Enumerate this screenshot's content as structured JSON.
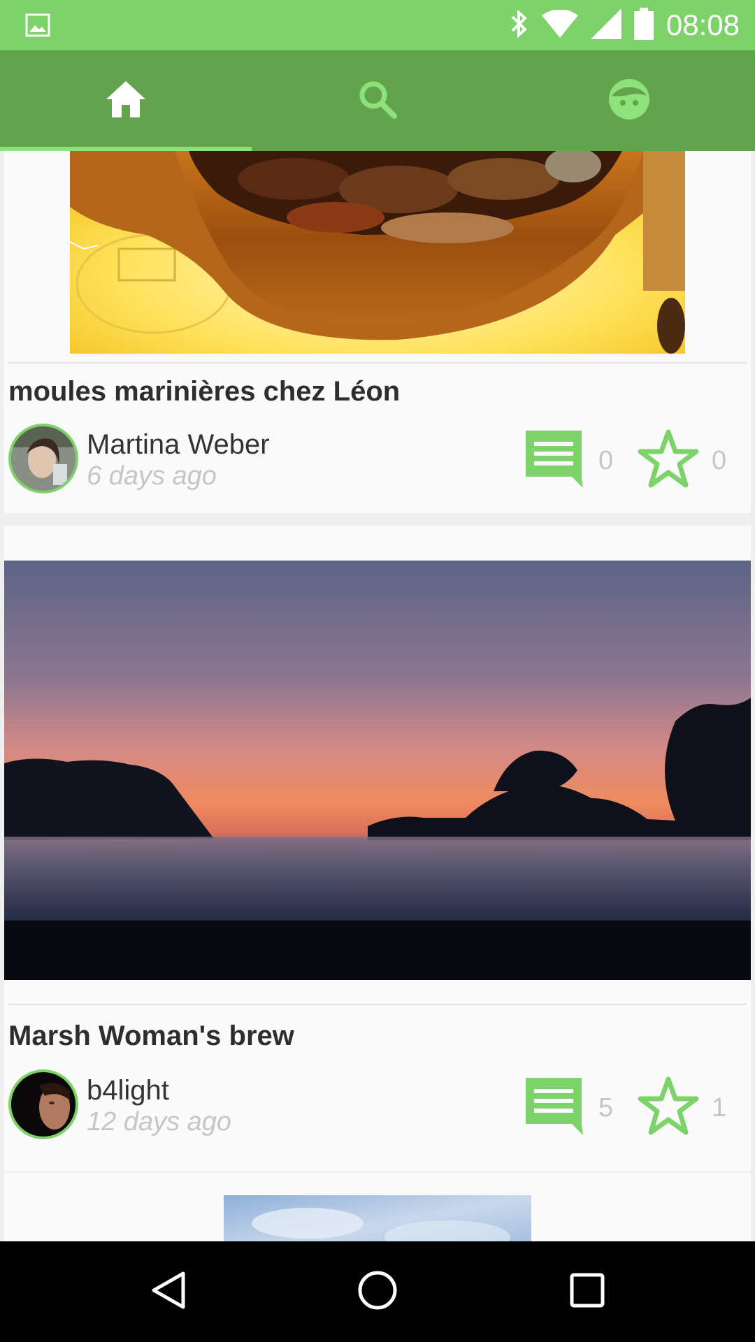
{
  "status_bar": {
    "time": "08:08",
    "background": "#7dd36a",
    "icons": [
      "image-notification-icon",
      "bluetooth-icon",
      "wifi-icon",
      "signal-icon",
      "battery-icon"
    ]
  },
  "tab_bar": {
    "background": "#63a34f",
    "tabs": [
      {
        "icon": "home-icon",
        "selected": true
      },
      {
        "icon": "search-icon",
        "selected": false
      },
      {
        "icon": "profile-face-icon",
        "selected": false
      }
    ]
  },
  "posts": [
    {
      "title": "moules marinières chez Léon",
      "author": "Martina Weber",
      "time_ago": "6 days ago",
      "comments": "0",
      "stars": "0"
    },
    {
      "title": "Marsh Woman's brew",
      "author": "b4light",
      "time_ago": "12 days ago",
      "comments": "5",
      "stars": "1"
    }
  ],
  "colors": {
    "accent": "#7dd36a",
    "tab_bar": "#63a34f",
    "muted_text": "#c6c6c6"
  },
  "nav_bar": {
    "buttons": [
      "back-icon",
      "home-circle-icon",
      "recents-icon"
    ]
  }
}
